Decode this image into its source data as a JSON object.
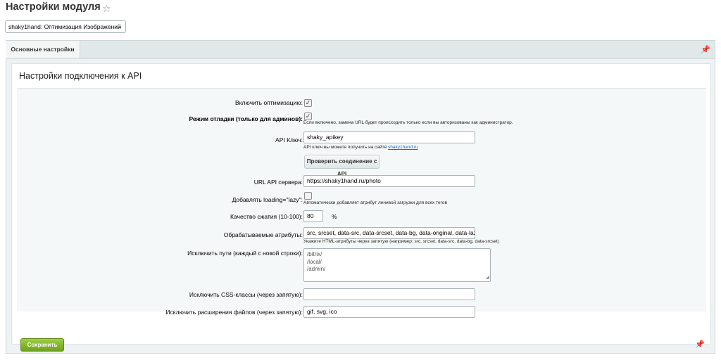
{
  "header": {
    "title": "Настройки модуля",
    "favorite_icon": "star-icon"
  },
  "module_select": {
    "value": "shaky1hand: Оптимизация Изображений"
  },
  "tabs": [
    {
      "label": "Основные настройки"
    }
  ],
  "section": {
    "title": "Настройки подключения к API"
  },
  "form": {
    "enable_optimization": {
      "label": "Включить оптимизацию:",
      "checked": true
    },
    "debug_mode": {
      "label": "Режим отладки (только для админов):",
      "checked": true,
      "hint": "Если включено, замена URL будет происходить только если вы авторизованы как администратор."
    },
    "api_key": {
      "label": "API Ключ:",
      "value": "shaky_apikey",
      "hint": "API ключ вы можете получить на сайте",
      "hint_link": "shaky1hand.ru"
    },
    "check_button": "Проверить соединение с API",
    "server_url": {
      "label": "URL API сервера:",
      "value": "https://shaky1hand.ru/photo"
    },
    "lazy_loading": {
      "label": "Добавлять loading=\"lazy\":",
      "checked": false,
      "hint": "Автоматически добавляет атрибут ленивой загрузки для всех тегов"
    },
    "quality": {
      "label": "Качество сжатия (10-100):",
      "value": "80",
      "unit": "%"
    },
    "attributes": {
      "label": "Обрабатываемые атрибуты:",
      "value": "src, srcset, data-src, data-srcset, data-bg, data-original, data-lazy",
      "hint": "Укажите HTML-атрибуты через запятую (например: src, srcset, data-src, data-bg, data-srcset)"
    },
    "exclude_paths": {
      "label": "Исключить пути (каждый с новой строки):",
      "lines": [
        "/bitrix/",
        "/local/",
        "/admin/"
      ]
    },
    "exclude_css": {
      "label": "Исключить CSS-классы (через запятую):",
      "value": ""
    },
    "exclude_ext": {
      "label": "Исключить расширения файлов (через запятую):",
      "value": "gif, svg, ico"
    }
  },
  "footer": {
    "save_label": "Сохранить"
  }
}
